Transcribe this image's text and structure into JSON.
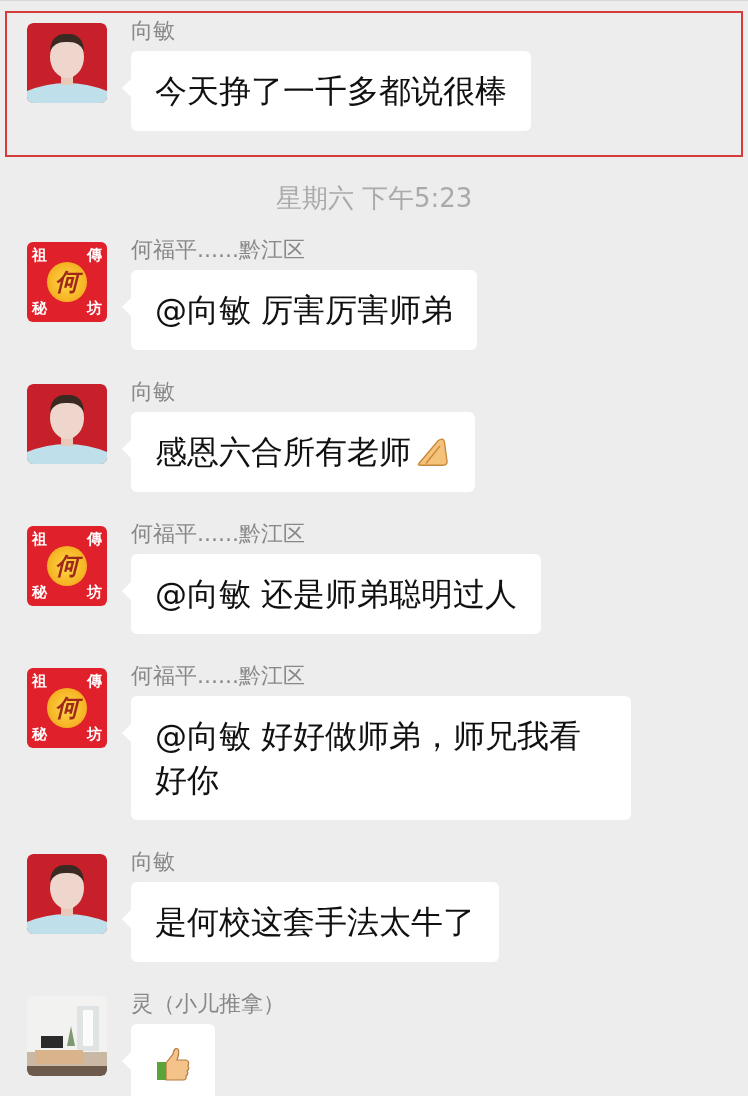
{
  "messages": [
    {
      "sender": "向敏",
      "avatar": {
        "kind": "portrait"
      },
      "kind": "text",
      "text": "今天挣了一千多都说很棒",
      "highlighted": true
    },
    {
      "kind": "time",
      "text": "星期六 下午5:23"
    },
    {
      "sender": "何福平......黔江区",
      "avatar": {
        "kind": "logo",
        "chars": [
          "祖",
          "傳",
          "秘",
          "坊",
          "何"
        ]
      },
      "kind": "text",
      "text": "@向敏 厉害厉害师弟",
      "highlighted": false
    },
    {
      "sender": "向敏",
      "avatar": {
        "kind": "portrait"
      },
      "kind": "text_emoji",
      "text": "感恩六合所有老师",
      "highlighted": false
    },
    {
      "sender": "何福平......黔江区",
      "avatar": {
        "kind": "logo",
        "chars": [
          "祖",
          "傳",
          "秘",
          "坊",
          "何"
        ]
      },
      "kind": "text",
      "text": "@向敏 还是师弟聪明过人",
      "highlighted": false
    },
    {
      "sender": "何福平......黔江区",
      "avatar": {
        "kind": "logo",
        "chars": [
          "祖",
          "傳",
          "秘",
          "坊",
          "何"
        ]
      },
      "kind": "text",
      "text": "@向敏 好好做师弟，师兄我看好你",
      "highlighted": false
    },
    {
      "sender": "向敏",
      "avatar": {
        "kind": "portrait"
      },
      "kind": "text",
      "text": "是何校这套手法太牛了",
      "highlighted": false
    },
    {
      "sender": "灵（小儿推拿）",
      "kind": "thumbs",
      "highlighted": false
    }
  ]
}
